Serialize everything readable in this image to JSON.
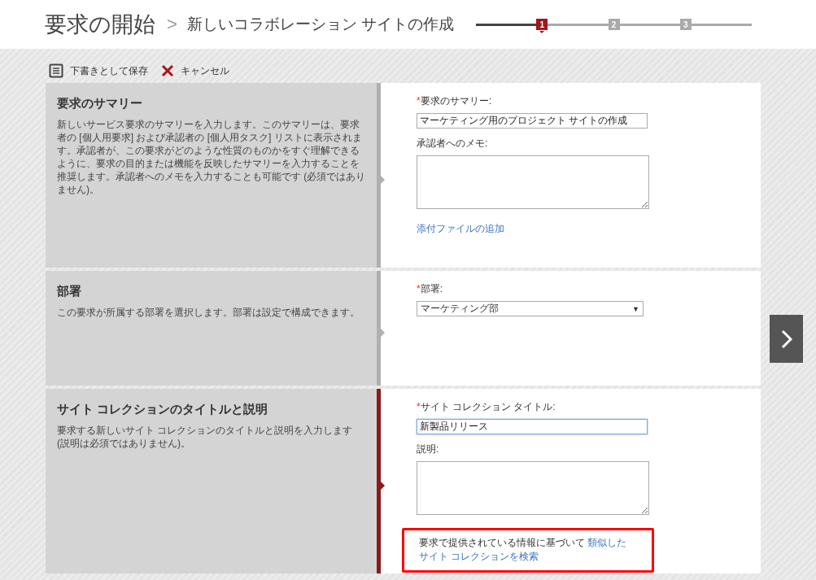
{
  "header": {
    "title": "要求の開始",
    "separator": ">",
    "subtitle": "新しいコラボレーション サイトの作成"
  },
  "steps": [
    {
      "label": "1",
      "selected": true
    },
    {
      "label": "2",
      "selected": false
    },
    {
      "label": "3",
      "selected": false
    }
  ],
  "toolbar": [
    {
      "kind": "save",
      "label": "下書きとして保存"
    },
    {
      "kind": "cancel",
      "label": "キャンセル"
    }
  ],
  "sections": [
    {
      "title": "要求のサマリー",
      "description": "新しいサービス要求のサマリーを入力します。このサマリーは、要求者の [個人用要求] および承認者の [個人用タスク] リストに表示されます。承認者が、この要求がどのような性質のものかをすぐ理解できるように、要求の目的または機能を反映したサマリーを入力することを推奨します。承認者へのメモを入力することも可能です (必須ではありません)。",
      "active": false,
      "fields": [
        {
          "kind": "text",
          "label": "要求のサマリー:",
          "required_mark": "*",
          "value": "マーケティング用のプロジェクト サイトの作成",
          "focused": false
        },
        {
          "kind": "textarea",
          "label": "承認者へのメモ:"
        },
        {
          "kind": "link",
          "text": "添付ファイルの追加"
        }
      ]
    },
    {
      "title": "部署",
      "description": "この要求が所属する部署を選択します。部署は設定で構成できます。",
      "active": false,
      "fields": [
        {
          "kind": "select",
          "label": "部署:",
          "required_mark": "*",
          "value": "マーケティング部",
          "caret": "▼"
        }
      ]
    },
    {
      "title": "サイト コレクションのタイトルと説明",
      "description": "要求する新しいサイト コレクションのタイトルと説明を入力します (説明は必須ではありません)。",
      "active": true,
      "fields": [
        {
          "kind": "text",
          "label": "サイト コレクション タイトル:",
          "required_mark": "*",
          "value": "新製品リリース",
          "focused": true
        },
        {
          "kind": "textarea",
          "label": "説明:"
        },
        {
          "kind": "notice",
          "text": "要求で提供されている情報に基づいて ",
          "links": [
            "類似した",
            "サイト コレクションを検索"
          ],
          "highlighted": true
        }
      ]
    }
  ]
}
